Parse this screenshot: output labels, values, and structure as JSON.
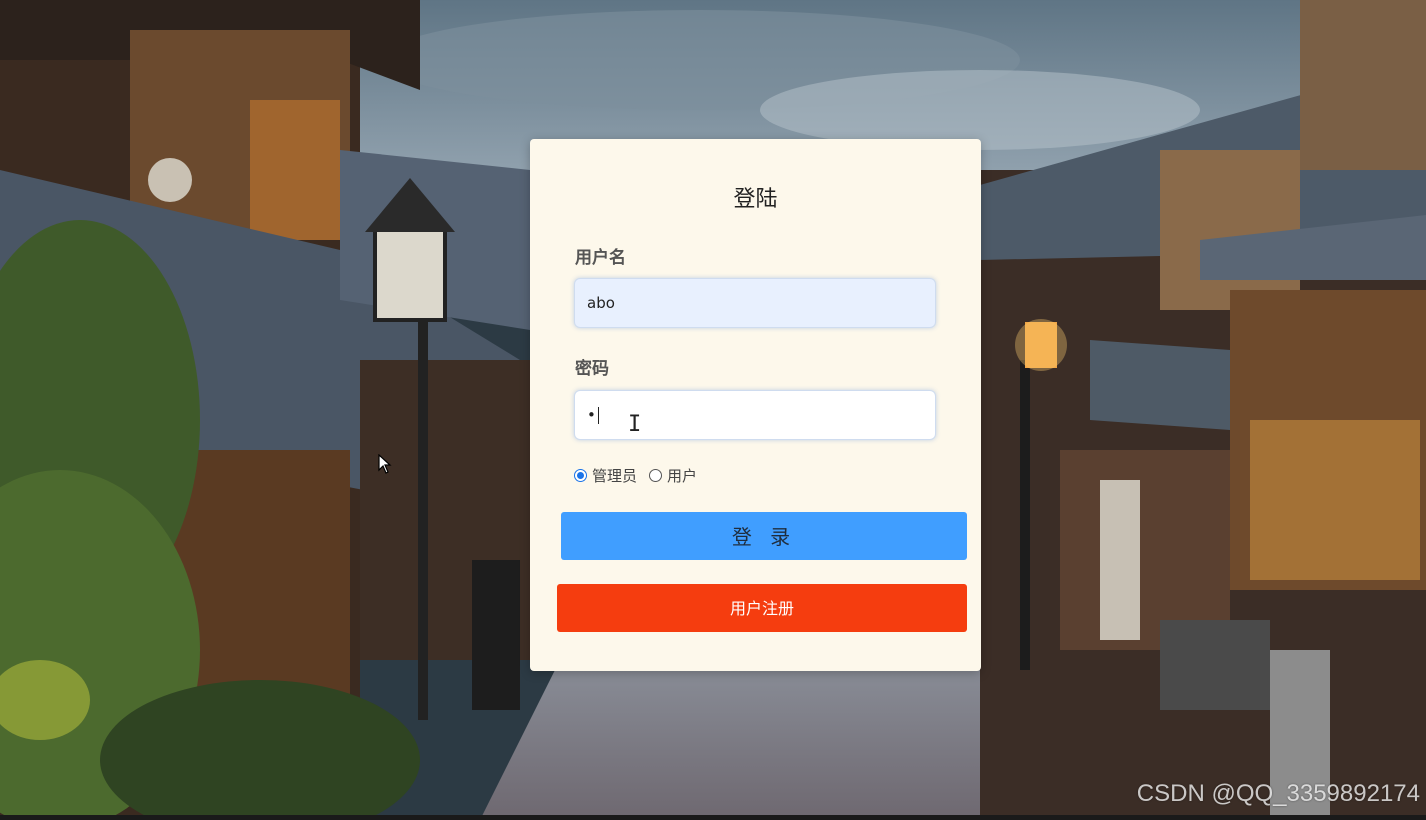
{
  "login_form": {
    "title": "登陆",
    "username_label": "用户名",
    "username_value": "abo",
    "password_label": "密码",
    "password_value": "•",
    "roles": [
      {
        "label": "管理员",
        "selected": true
      },
      {
        "label": "用户",
        "selected": false
      }
    ],
    "login_button": "登 录",
    "register_button": "用户注册"
  },
  "watermark": "CSDN @QQ_3359892174",
  "colors": {
    "card_bg": "#fdf8eb",
    "login_button": "#409eff",
    "register_button": "#f53d0f",
    "username_field_bg": "#e8f0fe"
  }
}
